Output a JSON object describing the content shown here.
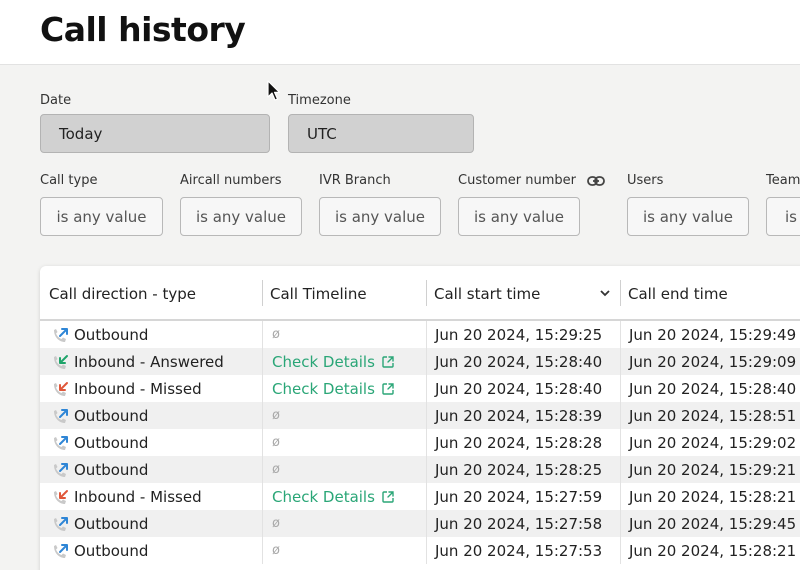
{
  "header": {
    "title": "Call history"
  },
  "filters": {
    "date": {
      "label": "Date",
      "value": "Today"
    },
    "timezone": {
      "label": "Timezone",
      "value": "UTC"
    },
    "row2": [
      {
        "label": "Call type",
        "value": "is any value"
      },
      {
        "label": "Aircall numbers",
        "value": "is any value"
      },
      {
        "label": "IVR Branch",
        "value": "is any value"
      },
      {
        "label": "Customer number",
        "value": "is any value"
      },
      {
        "label": "Users",
        "value": "is any value"
      },
      {
        "label": "Team",
        "value": "is"
      }
    ]
  },
  "table": {
    "columns": [
      "Call direction - type",
      "Call Timeline",
      "Call start time",
      "Call end time"
    ],
    "rows": [
      {
        "direction": "Outbound",
        "kind": "outbound",
        "timeline": "ø",
        "start": "Jun 20 2024, 15:29:25",
        "end": "Jun 20 2024, 15:29:49"
      },
      {
        "direction": "Inbound - Answered",
        "kind": "answered",
        "timeline": "Check Details",
        "start": "Jun 20 2024, 15:28:40",
        "end": "Jun 20 2024, 15:29:09"
      },
      {
        "direction": "Inbound - Missed",
        "kind": "missed",
        "timeline": "Check Details",
        "start": "Jun 20 2024, 15:28:40",
        "end": "Jun 20 2024, 15:28:40"
      },
      {
        "direction": "Outbound",
        "kind": "outbound",
        "timeline": "ø",
        "start": "Jun 20 2024, 15:28:39",
        "end": "Jun 20 2024, 15:28:51"
      },
      {
        "direction": "Outbound",
        "kind": "outbound",
        "timeline": "ø",
        "start": "Jun 20 2024, 15:28:28",
        "end": "Jun 20 2024, 15:29:02"
      },
      {
        "direction": "Outbound",
        "kind": "outbound",
        "timeline": "ø",
        "start": "Jun 20 2024, 15:28:25",
        "end": "Jun 20 2024, 15:29:21"
      },
      {
        "direction": "Inbound - Missed",
        "kind": "missed",
        "timeline": "Check Details",
        "start": "Jun 20 2024, 15:27:59",
        "end": "Jun 20 2024, 15:28:21"
      },
      {
        "direction": "Outbound",
        "kind": "outbound",
        "timeline": "ø",
        "start": "Jun 20 2024, 15:27:58",
        "end": "Jun 20 2024, 15:29:45"
      },
      {
        "direction": "Outbound",
        "kind": "outbound",
        "timeline": "ø",
        "start": "Jun 20 2024, 15:27:53",
        "end": "Jun 20 2024, 15:28:21"
      }
    ]
  },
  "icons": {
    "outbound": "outbound-call-icon",
    "answered": "inbound-answered-call-icon",
    "missed": "inbound-missed-call-icon",
    "external": "external-link-icon",
    "link": "link-icon",
    "sort": "chevron-down-icon"
  },
  "colors": {
    "outbound": "#2f86d6",
    "answered": "#1fa46a",
    "missed": "#e0573a",
    "link": "#2aa677"
  }
}
